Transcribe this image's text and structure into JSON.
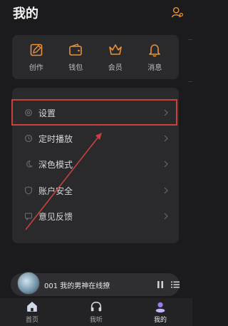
{
  "header": {
    "title": "我的"
  },
  "quick_actions": [
    {
      "label": "创作",
      "icon": "edit-icon"
    },
    {
      "label": "钱包",
      "icon": "wallet-icon"
    },
    {
      "label": "会员",
      "icon": "crown-icon"
    },
    {
      "label": "消息",
      "icon": "bell-icon"
    }
  ],
  "settings_list": [
    {
      "label": "设置",
      "icon": "gear-icon"
    },
    {
      "label": "定时播放",
      "icon": "clock-icon"
    },
    {
      "label": "深色模式",
      "icon": "moon-icon"
    },
    {
      "label": "账户安全",
      "icon": "shield-icon"
    },
    {
      "label": "意见反馈",
      "icon": "feedback-icon"
    }
  ],
  "player": {
    "title": "001 我的男神在线撩"
  },
  "tabs": [
    {
      "label": "首页",
      "icon": "home-icon"
    },
    {
      "label": "我听",
      "icon": "headphones-icon"
    },
    {
      "label": "我的",
      "icon": "profile-icon",
      "active": true
    }
  ],
  "colors": {
    "accent": "#e8913a",
    "highlight": "#c9413c",
    "active_tab": "#9b7cf0"
  }
}
